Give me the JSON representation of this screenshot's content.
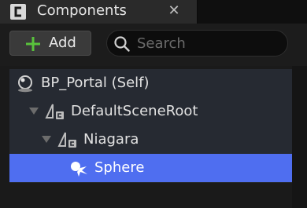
{
  "tab": {
    "title": "Components",
    "icon": "blueprint-component-icon",
    "close_glyph": "✕"
  },
  "toolbar": {
    "add_label": "Add",
    "search_placeholder": "Search",
    "search_value": ""
  },
  "tree": {
    "items": [
      {
        "label": "BP_Portal (Self)",
        "icon": "actor-sphere-icon",
        "expanded": true
      },
      {
        "label": "DefaultSceneRoot",
        "icon": "scene-component-icon",
        "expanded": true
      },
      {
        "label": "Niagara",
        "icon": "scene-component-icon",
        "expanded": true
      },
      {
        "label": "Sphere",
        "icon": "point-light-icon",
        "selected": true
      }
    ]
  },
  "colors": {
    "selection": "#4f6ef0",
    "tree_bg": "#262a32",
    "add_plus": "#59c23c"
  }
}
